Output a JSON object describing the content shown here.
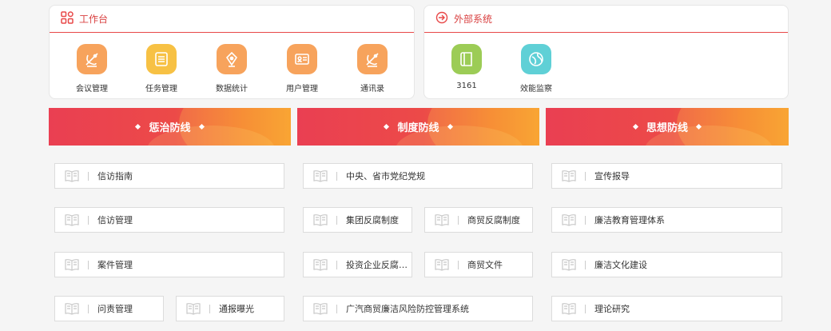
{
  "workbench": {
    "title": "工作台",
    "apps": [
      {
        "label": "会议管理",
        "icon": "satellite-dish-icon",
        "color": "#f7a35c"
      },
      {
        "label": "任务管理",
        "icon": "task-list-icon",
        "color": "#f7c144"
      },
      {
        "label": "数据统计",
        "icon": "pen-nib-icon",
        "color": "#f7a35c"
      },
      {
        "label": "用户管理",
        "icon": "id-card-icon",
        "color": "#f7a35c"
      },
      {
        "label": "通讯录",
        "icon": "satellite-dish-icon",
        "color": "#f7a35c"
      }
    ]
  },
  "external": {
    "title": "外部系统",
    "apps": [
      {
        "label": "3161",
        "icon": "book-icon",
        "color": "#9ccc56"
      },
      {
        "label": "效能监察",
        "icon": "globe-icon",
        "color": "#5fd0d6"
      }
    ]
  },
  "columns": [
    {
      "title": "惩治防线",
      "items": [
        "信访指南",
        "信访管理",
        "案件管理",
        "问责管理",
        "通报曝光"
      ]
    },
    {
      "title": "制度防线",
      "items": [
        "中央、省市党纪党规",
        "集团反腐制度",
        "商贸反腐制度",
        "投资企业反腐制度",
        "商贸文件",
        "广汽商贸廉洁风险防控管理系统"
      ]
    },
    {
      "title": "思想防线",
      "items": [
        "宣传报导",
        "廉洁教育管理体系",
        "廉洁文化建设",
        "理论研究"
      ]
    }
  ],
  "colors": {
    "accent": "#e84848",
    "bannerStart": "#ea3f52",
    "bannerEnd": "#f79a2a"
  }
}
